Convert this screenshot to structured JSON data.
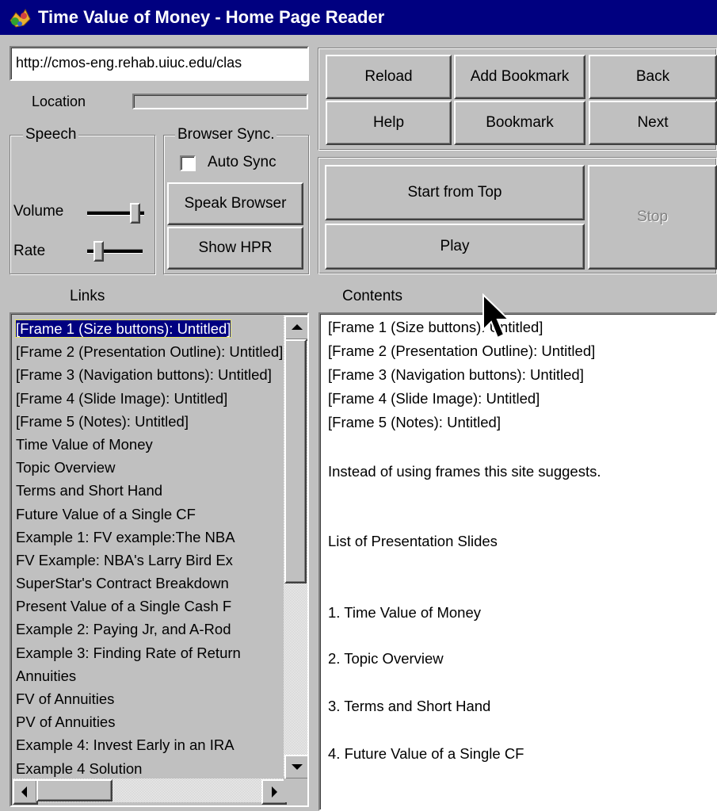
{
  "window": {
    "title": "Time Value of Money - Home Page Reader",
    "app_icon": "home-page-reader-icon"
  },
  "address": {
    "url": "http://cmos-eng.rehab.uiuc.edu/clas",
    "location_label": "Location"
  },
  "nav_buttons": {
    "reload": "Reload",
    "add_bookmark": "Add Bookmark",
    "back": "Back",
    "help": "Help",
    "bookmark": "Bookmark",
    "next": "Next"
  },
  "speech": {
    "group_label": "Speech",
    "volume_label": "Volume",
    "rate_label": "Rate"
  },
  "browser_sync": {
    "group_label": "Browser Sync.",
    "auto_sync_label": "Auto Sync",
    "auto_sync_checked": false,
    "speak_browser": "Speak Browser",
    "show_hpr": "Show HPR"
  },
  "playback": {
    "start_from_top": "Start from Top",
    "play": "Play",
    "stop": "Stop",
    "stop_enabled": false
  },
  "links": {
    "header": "Links",
    "items": [
      "[Frame 1 (Size buttons): Untitled]",
      "[Frame 2 (Presentation Outline): Untitled]",
      "[Frame 3 (Navigation buttons): Untitled]",
      "[Frame 4 (Slide Image): Untitled]",
      "[Frame 5 (Notes): Untitled]",
      "Time Value of Money",
      "Topic Overview",
      "Terms and Short Hand",
      "Future Value of a Single CF",
      "Example 1: FV example:The NBA",
      "FV Example: NBA's Larry Bird Ex",
      "SuperStar's Contract Breakdown",
      "Present Value of a Single Cash F",
      "Example 2: Paying Jr, and A-Rod",
      "Example 3: Finding Rate of Return",
      "Annuities",
      "FV of Annuities",
      "PV of Annuities",
      "Example 4: Invest Early in an IRA",
      "Example 4 Solution"
    ]
  },
  "contents": {
    "header": "Contents",
    "lines": [
      "[Frame 1 (Size buttons): Untitled]",
      "[Frame 2 (Presentation Outline): Untitled]",
      "[Frame 3 (Navigation buttons): Untitled]",
      "[Frame 4 (Slide Image): Untitled]",
      "[Frame 5 (Notes): Untitled]",
      "Instead of using frames this site suggests.",
      "List of Presentation Slides",
      "1. Time Value of Money",
      "2. Topic Overview",
      "3. Terms and Short Hand",
      "4. Future Value of a Single CF"
    ]
  }
}
